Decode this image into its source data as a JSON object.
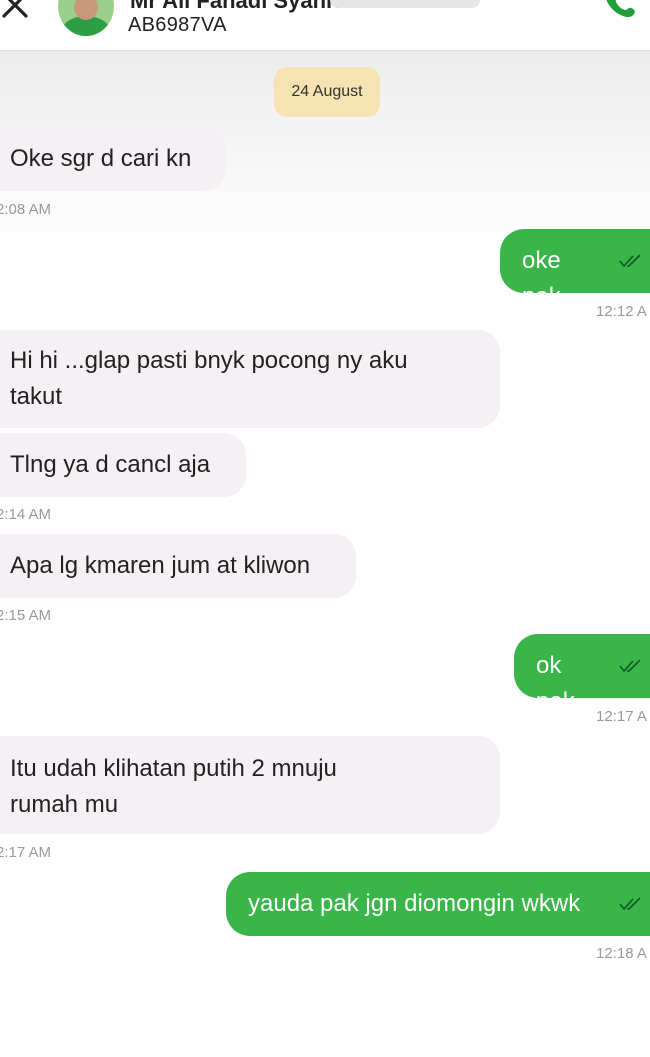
{
  "header": {
    "contact_name": "Mr Ali Fahadi Syahri",
    "plate": "AB6987VA"
  },
  "chat": {
    "date_chip": "24 August",
    "messages": [
      {
        "dir": "in",
        "text": "Oke sgr d cari kn",
        "time": "2:08 AM"
      },
      {
        "dir": "out",
        "text": "oke pak",
        "time": "12:12 A"
      },
      {
        "dir": "in",
        "text": "Hi hi ...glap pasti bnyk pocong ny aku takut",
        "time": ""
      },
      {
        "dir": "in",
        "text": "Tlng ya d cancl aja",
        "time": "2:14 AM"
      },
      {
        "dir": "in",
        "text": "Apa lg kmaren jum at kliwon",
        "time": "2:15 AM"
      },
      {
        "dir": "out",
        "text": "ok pak",
        "time": "12:17 A"
      },
      {
        "dir": "in",
        "text": "Itu udah klihatan putih 2 mnuju rumah mu",
        "time": "2:17 AM"
      },
      {
        "dir": "out",
        "text": "yauda pak jgn diomongin wkwk",
        "time": "12:18 A"
      }
    ]
  },
  "colors": {
    "outgoing_bubble": "#3ab54a",
    "incoming_bubble": "#f4f0f4",
    "date_chip": "#f6e3b1",
    "accent": "#1f9e3a"
  },
  "icons": {
    "close": "close-icon",
    "call": "phone-icon",
    "read": "double-check-icon"
  }
}
